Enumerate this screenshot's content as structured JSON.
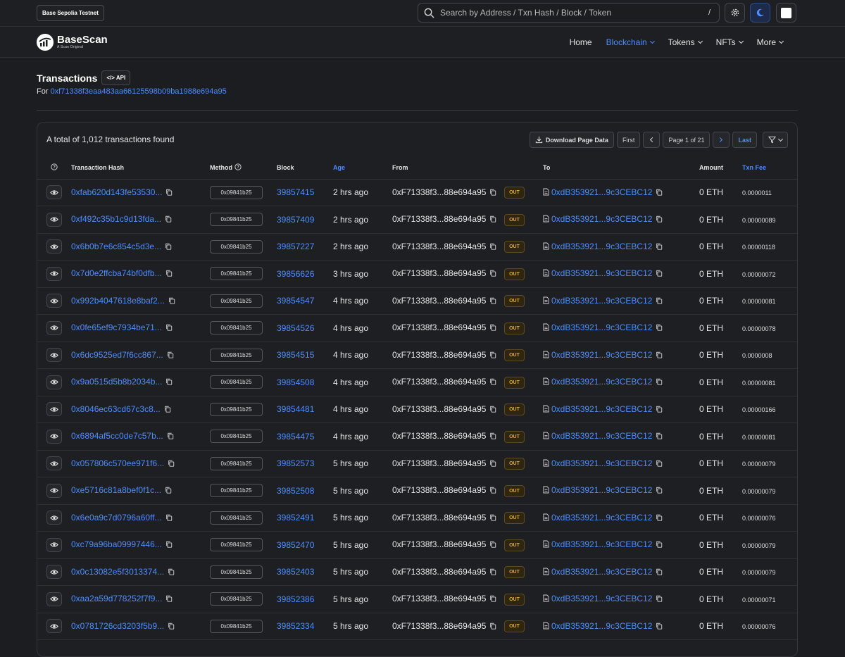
{
  "network": "Base Sepolia Testnet",
  "search": {
    "placeholder": "Search by Address / Txn Hash / Block / Token",
    "shortcut": "/"
  },
  "brand": {
    "name": "BaseScan",
    "tagline": "A Scan Original"
  },
  "nav": [
    {
      "label": "Home",
      "active": false,
      "dropdown": false
    },
    {
      "label": "Blockchain",
      "active": true,
      "dropdown": true
    },
    {
      "label": "Tokens",
      "active": false,
      "dropdown": true
    },
    {
      "label": "NFTs",
      "active": false,
      "dropdown": true
    },
    {
      "label": "More",
      "active": false,
      "dropdown": true
    }
  ],
  "page": {
    "title": "Transactions",
    "api_label": "API",
    "for_label": "For",
    "address": "0xf71338f3eaa483aa66125598b09ba1988e694a95"
  },
  "table": {
    "total_text": "A total of 1,012 transactions found",
    "download_label": "Download Page Data",
    "first_label": "First",
    "page_label": "Page 1 of 21",
    "last_label": "Last",
    "columns": {
      "hash": "Transaction Hash",
      "method": "Method",
      "block": "Block",
      "age": "Age",
      "from": "From",
      "to": "To",
      "amount": "Amount",
      "fee": "Txn Fee"
    },
    "rows": [
      {
        "hash": "0xfab620d143fe53530...",
        "method": "0x09841b25",
        "block": "39857415",
        "age": "2 hrs ago",
        "from": "0xF71338f3...88e694a95",
        "dir": "OUT",
        "to": "0xdB353921...9c3CEBC12",
        "amount": "0 ETH",
        "fee": "0.0000011"
      },
      {
        "hash": "0xf492c35b1c9d13fda...",
        "method": "0x09841b25",
        "block": "39857409",
        "age": "2 hrs ago",
        "from": "0xF71338f3...88e694a95",
        "dir": "OUT",
        "to": "0xdB353921...9c3CEBC12",
        "amount": "0 ETH",
        "fee": "0.00000089"
      },
      {
        "hash": "0x6b0b7e6c854c5d3e...",
        "method": "0x09841b25",
        "block": "39857227",
        "age": "2 hrs ago",
        "from": "0xF71338f3...88e694a95",
        "dir": "OUT",
        "to": "0xdB353921...9c3CEBC12",
        "amount": "0 ETH",
        "fee": "0.00000118"
      },
      {
        "hash": "0x7d0e2ffcba74bf0dfb...",
        "method": "0x09841b25",
        "block": "39856626",
        "age": "3 hrs ago",
        "from": "0xF71338f3...88e694a95",
        "dir": "OUT",
        "to": "0xdB353921...9c3CEBC12",
        "amount": "0 ETH",
        "fee": "0.00000072"
      },
      {
        "hash": "0x992b4047618e8baf2...",
        "method": "0x09841b25",
        "block": "39854547",
        "age": "4 hrs ago",
        "from": "0xF71338f3...88e694a95",
        "dir": "OUT",
        "to": "0xdB353921...9c3CEBC12",
        "amount": "0 ETH",
        "fee": "0.00000081"
      },
      {
        "hash": "0x0fe65ef9c7934be71...",
        "method": "0x09841b25",
        "block": "39854526",
        "age": "4 hrs ago",
        "from": "0xF71338f3...88e694a95",
        "dir": "OUT",
        "to": "0xdB353921...9c3CEBC12",
        "amount": "0 ETH",
        "fee": "0.00000078"
      },
      {
        "hash": "0x6dc9525ed7f6cc867...",
        "method": "0x09841b25",
        "block": "39854515",
        "age": "4 hrs ago",
        "from": "0xF71338f3...88e694a95",
        "dir": "OUT",
        "to": "0xdB353921...9c3CEBC12",
        "amount": "0 ETH",
        "fee": "0.0000008"
      },
      {
        "hash": "0x9a0515d5b8b2034b...",
        "method": "0x09841b25",
        "block": "39854508",
        "age": "4 hrs ago",
        "from": "0xF71338f3...88e694a95",
        "dir": "OUT",
        "to": "0xdB353921...9c3CEBC12",
        "amount": "0 ETH",
        "fee": "0.00000081"
      },
      {
        "hash": "0x8046ec63cd67c3c8...",
        "method": "0x09841b25",
        "block": "39854481",
        "age": "4 hrs ago",
        "from": "0xF71338f3...88e694a95",
        "dir": "OUT",
        "to": "0xdB353921...9c3CEBC12",
        "amount": "0 ETH",
        "fee": "0.00000166"
      },
      {
        "hash": "0x6894af5cc0de7c57b...",
        "method": "0x09841b25",
        "block": "39854475",
        "age": "4 hrs ago",
        "from": "0xF71338f3...88e694a95",
        "dir": "OUT",
        "to": "0xdB353921...9c3CEBC12",
        "amount": "0 ETH",
        "fee": "0.00000081"
      },
      {
        "hash": "0x057806c570ee971f6...",
        "method": "0x09841b25",
        "block": "39852573",
        "age": "5 hrs ago",
        "from": "0xF71338f3...88e694a95",
        "dir": "OUT",
        "to": "0xdB353921...9c3CEBC12",
        "amount": "0 ETH",
        "fee": "0.00000079"
      },
      {
        "hash": "0xe5716c81a8bef0f1c...",
        "method": "0x09841b25",
        "block": "39852508",
        "age": "5 hrs ago",
        "from": "0xF71338f3...88e694a95",
        "dir": "OUT",
        "to": "0xdB353921...9c3CEBC12",
        "amount": "0 ETH",
        "fee": "0.00000079"
      },
      {
        "hash": "0x6e0a9c7d0796a60ff...",
        "method": "0x09841b25",
        "block": "39852491",
        "age": "5 hrs ago",
        "from": "0xF71338f3...88e694a95",
        "dir": "OUT",
        "to": "0xdB353921...9c3CEBC12",
        "amount": "0 ETH",
        "fee": "0.00000076"
      },
      {
        "hash": "0xc79a96ba09997446...",
        "method": "0x09841b25",
        "block": "39852470",
        "age": "5 hrs ago",
        "from": "0xF71338f3...88e694a95",
        "dir": "OUT",
        "to": "0xdB353921...9c3CEBC12",
        "amount": "0 ETH",
        "fee": "0.00000079"
      },
      {
        "hash": "0x0c13082e5f3013374...",
        "method": "0x09841b25",
        "block": "39852403",
        "age": "5 hrs ago",
        "from": "0xF71338f3...88e694a95",
        "dir": "OUT",
        "to": "0xdB353921...9c3CEBC12",
        "amount": "0 ETH",
        "fee": "0.00000079"
      },
      {
        "hash": "0xaa2a59d778252f7f9...",
        "method": "0x09841b25",
        "block": "39852386",
        "age": "5 hrs ago",
        "from": "0xF71338f3...88e694a95",
        "dir": "OUT",
        "to": "0xdB353921...9c3CEBC12",
        "amount": "0 ETH",
        "fee": "0.00000071"
      },
      {
        "hash": "0x0781726cd3203f5b9...",
        "method": "0x09841b25",
        "block": "39852334",
        "age": "5 hrs ago",
        "from": "0xF71338f3...88e694a95",
        "dir": "OUT",
        "to": "0xdB353921...9c3CEBC12",
        "amount": "0 ETH",
        "fee": "0.00000076"
      }
    ]
  }
}
